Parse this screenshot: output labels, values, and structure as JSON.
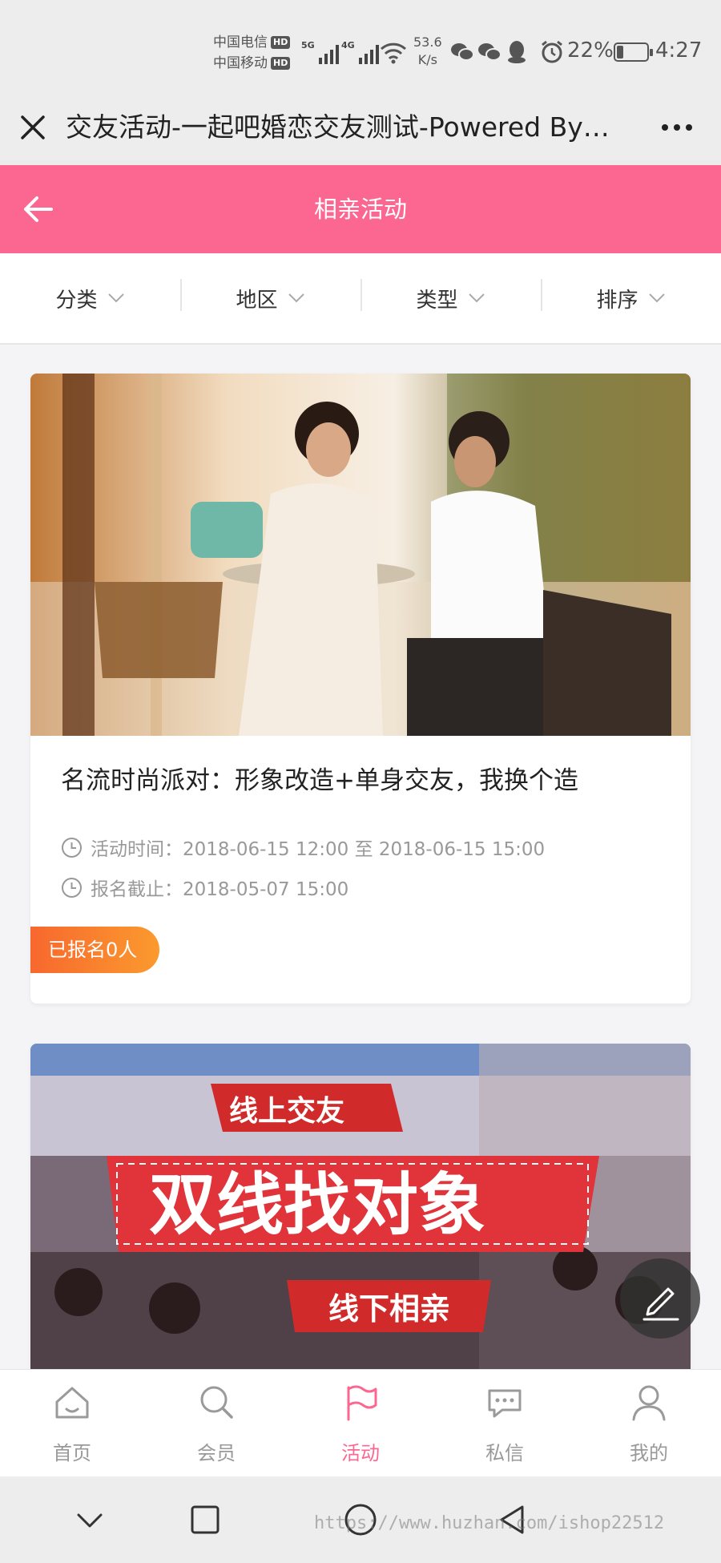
{
  "status_bar": {
    "carrier1": "中国电信",
    "carrier2": "中国移动",
    "hd": "HD",
    "net1": "5G",
    "net2": "4G",
    "speed_value": "53.6",
    "speed_unit": "K/s",
    "battery": "22%",
    "battery_level": 0.22,
    "time": "4:27"
  },
  "browser": {
    "title": "交友活动-一起吧婚恋交友测试-Powered By…"
  },
  "header": {
    "title": "相亲活动"
  },
  "filters": [
    {
      "label": "分类"
    },
    {
      "label": "地区"
    },
    {
      "label": "类型"
    },
    {
      "label": "排序"
    }
  ],
  "events": [
    {
      "title": "名流时尚派对：形象改造+单身交友，我换个造",
      "time_label": "活动时间：",
      "time_value": "2018-06-15 12:00 至 2018-06-15 15:00",
      "deadline_label": "报名截止：",
      "deadline_value": "2018-05-07 15:00",
      "signup": "已报名0人"
    },
    {
      "banner_top": "线上交友",
      "banner_main": "双线找对象",
      "banner_bottom": "线下相亲"
    }
  ],
  "tabs": [
    {
      "label": "首页",
      "icon": "home-icon"
    },
    {
      "label": "会员",
      "icon": "search-icon"
    },
    {
      "label": "活动",
      "icon": "flag-icon"
    },
    {
      "label": "私信",
      "icon": "chat-icon"
    },
    {
      "label": "我的",
      "icon": "user-icon"
    }
  ],
  "active_tab": "活动",
  "watermark": "https://www.huzhan.com/ishop22512",
  "colors": {
    "brand": "#fb6791",
    "badge_start": "#f7682e",
    "badge_end": "#fb9a2e"
  }
}
